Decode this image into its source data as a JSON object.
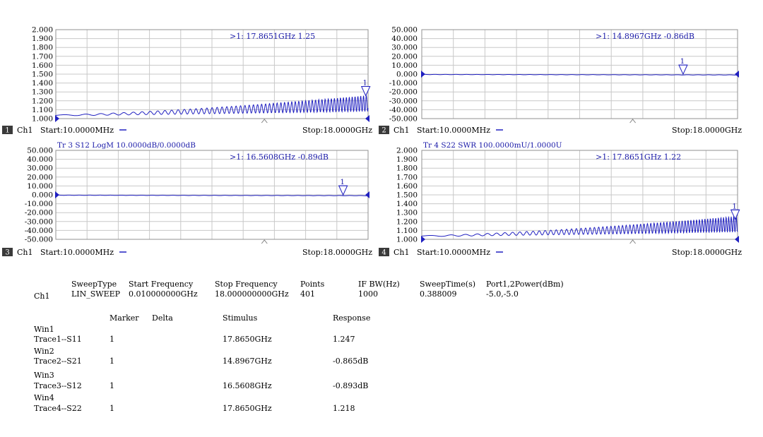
{
  "chart_data": [
    {
      "type": "line",
      "window": "1",
      "trace_header": "",
      "y_ticks": [
        "2.000",
        "1.900",
        "1.800",
        "1.700",
        "1.600",
        "1.500",
        "1.400",
        "1.300",
        "1.200",
        "1.100",
        "1.000"
      ],
      "ylim": [
        1.0,
        2.0
      ],
      "xlim_ghz": [
        0.01,
        18.0
      ],
      "marker_readout": ">1:   17.8651GHz 1.25",
      "marker": {
        "label": "1",
        "x_ghz": 17.8651,
        "y": 1.25
      },
      "footer": {
        "win_num": "1",
        "ch": "Ch1",
        "start": "Start:10.0000MHz",
        "stop": "Stop:18.0000GHz"
      },
      "series": [
        {
          "shape": "swr",
          "base": 1.03,
          "end_amp": 0.17,
          "cycles": 46
        }
      ],
      "reference_value": 1.0
    },
    {
      "type": "line",
      "window": "2",
      "trace_header": "",
      "y_ticks": [
        "50.000",
        "40.000",
        "30.000",
        "20.000",
        "10.000",
        "0.000",
        "-10.000",
        "-20.000",
        "-30.000",
        "-40.000",
        "-50.000"
      ],
      "ylim": [
        -50,
        50
      ],
      "xlim_ghz": [
        0.01,
        18.0
      ],
      "marker_readout": ">1:   14.8967GHz -0.86dB",
      "marker": {
        "label": "1",
        "x_ghz": 14.8967,
        "y": -0.865
      },
      "footer": {
        "win_num": "2",
        "ch": "Ch1",
        "start": "Start:10.0000MHz",
        "stop": "Stop:18.0000GHz"
      },
      "series": [
        {
          "shape": "flat",
          "level": -0.4,
          "end_level": -0.9
        }
      ],
      "reference_value": 0.0
    },
    {
      "type": "line",
      "window": "3",
      "trace_header": "Tr 3  S12 LogM 10.0000dB/0.0000dB",
      "y_ticks": [
        "50.000",
        "40.000",
        "30.000",
        "20.000",
        "10.000",
        "0.000",
        "-10.000",
        "-20.000",
        "-30.000",
        "-40.000",
        "-50.000"
      ],
      "ylim": [
        -50,
        50
      ],
      "xlim_ghz": [
        0.01,
        18.0
      ],
      "marker_readout": ">1:   16.5608GHz -0.89dB",
      "marker": {
        "label": "1",
        "x_ghz": 16.5608,
        "y": -0.893
      },
      "footer": {
        "win_num": "3",
        "ch": "Ch1",
        "start": "Start:10.0000MHz",
        "stop": "Stop:18.0000GHz"
      },
      "series": [
        {
          "shape": "flat",
          "level": -0.4,
          "end_level": -0.9
        }
      ],
      "reference_value": 0.0
    },
    {
      "type": "line",
      "window": "4",
      "trace_header": "Tr 4  S22 SWR 100.0000mU/1.0000U",
      "y_ticks": [
        "2.000",
        "1.900",
        "1.800",
        "1.700",
        "1.600",
        "1.500",
        "1.400",
        "1.300",
        "1.200",
        "1.100",
        "1.000"
      ],
      "ylim": [
        1.0,
        2.0
      ],
      "xlim_ghz": [
        0.01,
        18.0
      ],
      "marker_readout": ">1:   17.8651GHz 1.22",
      "marker": {
        "label": "1",
        "x_ghz": 17.8651,
        "y": 1.22
      },
      "footer": {
        "win_num": "4",
        "ch": "Ch1",
        "start": "Start:10.0000MHz",
        "stop": "Stop:18.0000GHz"
      },
      "series": [
        {
          "shape": "swr",
          "base": 1.03,
          "end_amp": 0.17,
          "cycles": 52
        }
      ],
      "reference_value": 1.0
    }
  ],
  "sweep": {
    "headers": [
      "SweepType",
      "Start Frequency",
      "Stop Frequency",
      "Points",
      "IF BW(Hz)",
      "SweepTime(s)",
      "Port1,2Power(dBm)"
    ],
    "channel": "Ch1",
    "values": [
      "LIN_SWEEP",
      "0.010000000GHz",
      "18.000000000GHz",
      "401",
      "1000",
      "0.388009",
      "-5.0,-5.0"
    ]
  },
  "markers": {
    "headers": [
      "Marker",
      "Delta",
      "Stimulus",
      "Response"
    ],
    "rows": [
      {
        "win": "Win1",
        "trace": "Trace1--S11",
        "marker": "1",
        "stimulus": "17.8650GHz",
        "response": "1.247"
      },
      {
        "win": "Win2",
        "trace": "Trace2--S21",
        "marker": "1",
        "stimulus": "14.8967GHz",
        "response": "-0.865dB"
      },
      {
        "win": "Win3",
        "trace": "Trace3--S12",
        "marker": "1",
        "stimulus": "16.5608GHz",
        "response": "-0.893dB"
      },
      {
        "win": "Win4",
        "trace": "Trace4--S22",
        "marker": "1",
        "stimulus": "17.8650GHz",
        "response": "1.218"
      }
    ]
  },
  "colors": {
    "trace": "#2020c0",
    "grid": "#c8c8c8",
    "frame": "#909090",
    "text": "#000000",
    "header": "#1a1aa8",
    "badge": "#3a3a3a"
  }
}
